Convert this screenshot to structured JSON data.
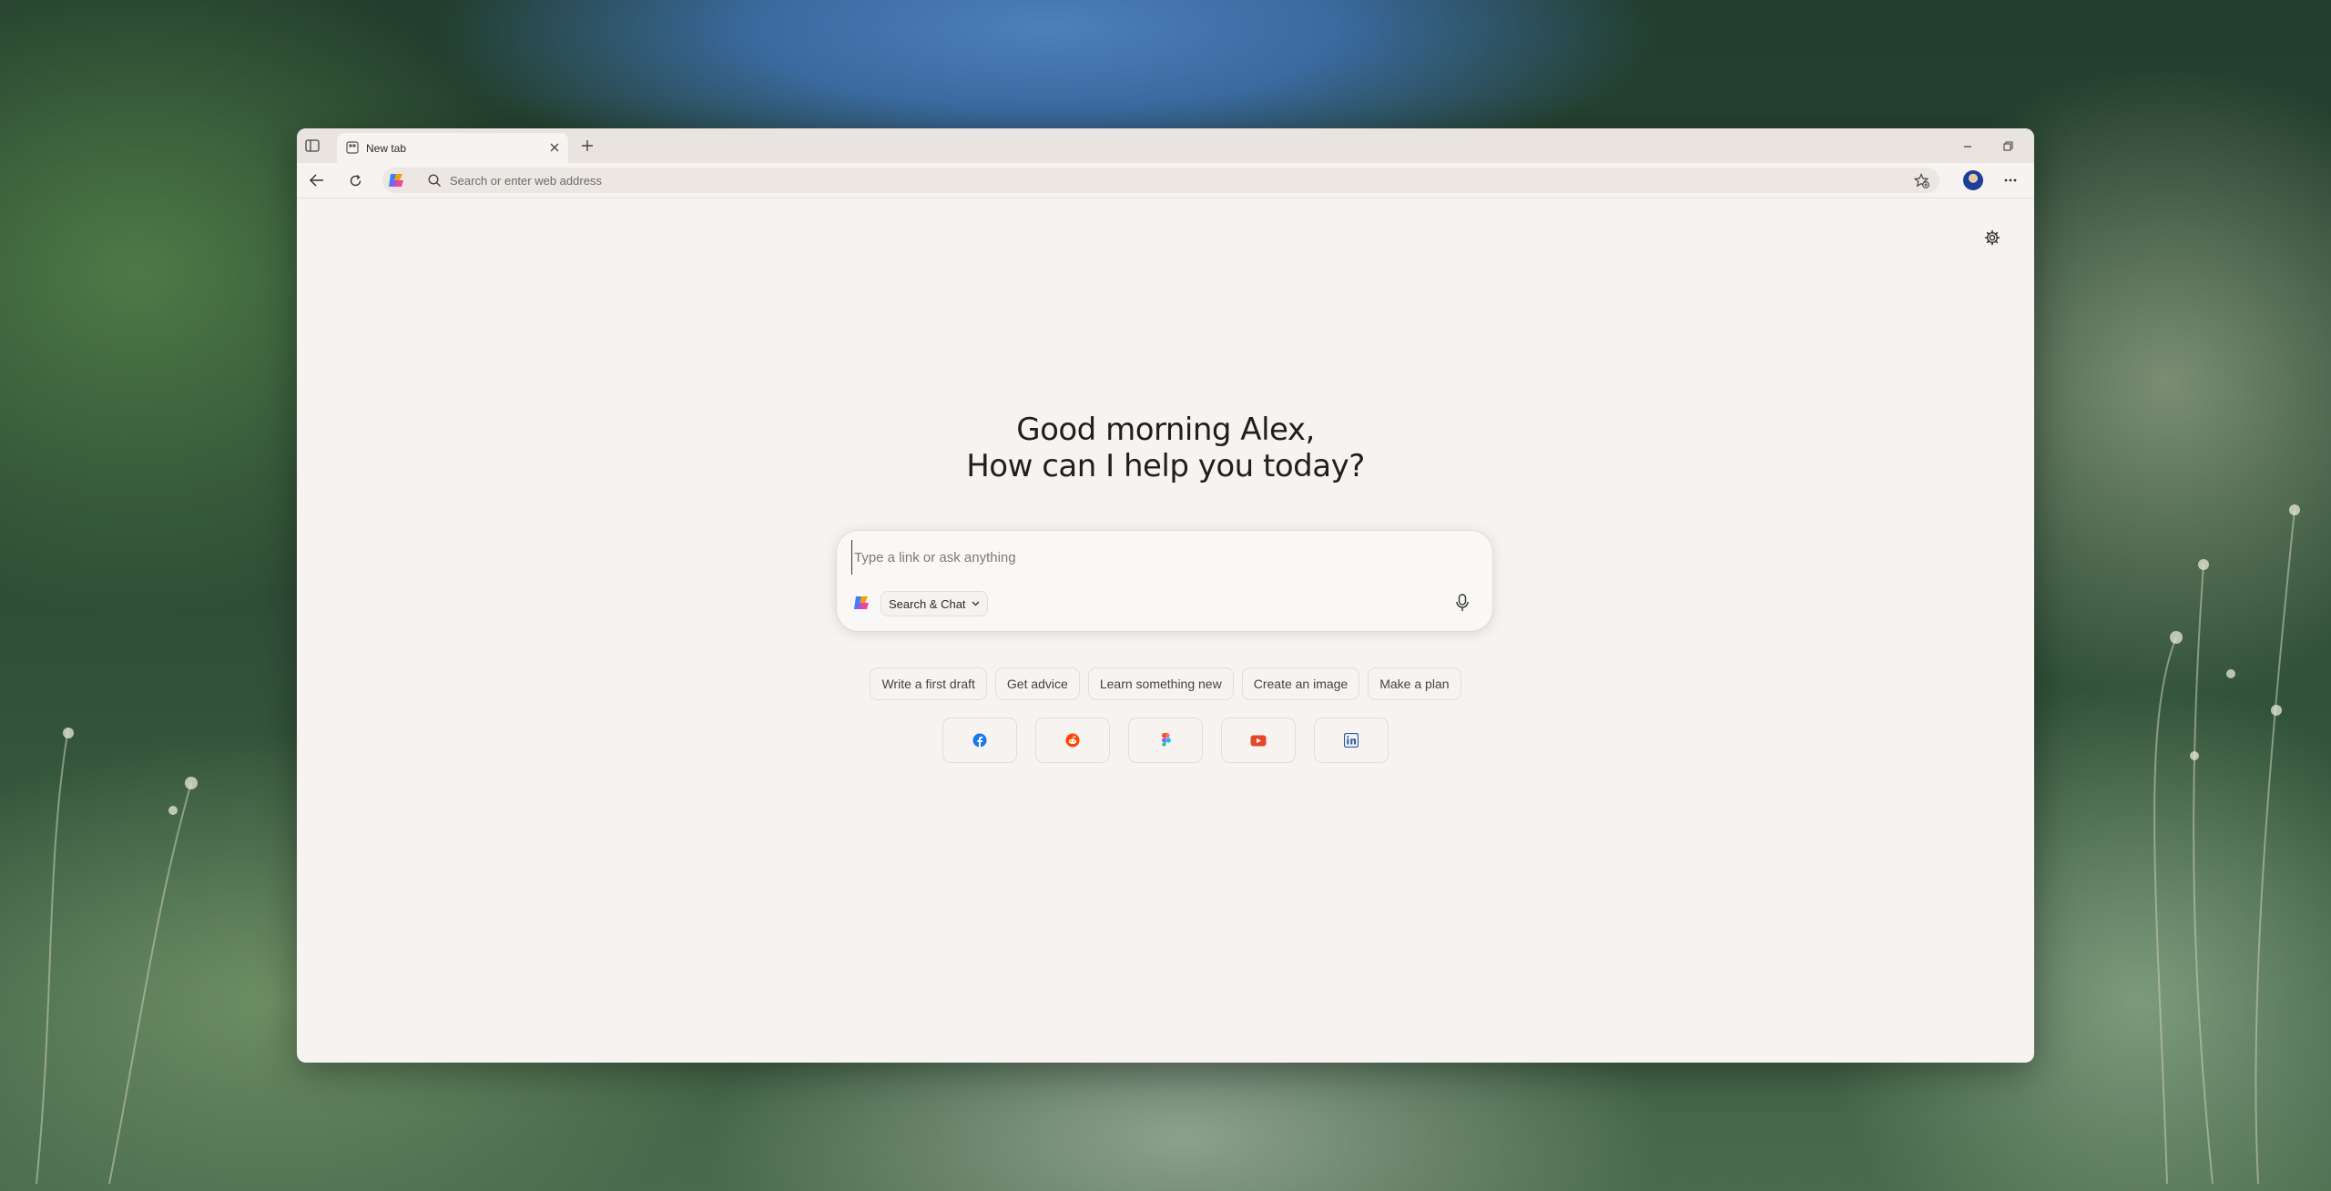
{
  "tab": {
    "title": "New tab"
  },
  "address_bar": {
    "placeholder": "Search or enter web address"
  },
  "greeting": {
    "line1": "Good morning Alex,",
    "line2": "How can I help you today?"
  },
  "chat": {
    "placeholder": "Type a link or ask anything",
    "mode_label": "Search & Chat"
  },
  "suggestions": [
    "Write a first draft",
    "Get advice",
    "Learn something new",
    "Create an image",
    "Make a plan"
  ],
  "shortcuts": [
    {
      "name": "facebook-icon",
      "color": "#1877f2"
    },
    {
      "name": "reddit-icon",
      "color": "#ff4500"
    },
    {
      "name": "figma-icon",
      "color": "#a259ff"
    },
    {
      "name": "youtube-icon",
      "color": "#ff0000"
    },
    {
      "name": "linkedin-icon",
      "color": "#0a66c2"
    }
  ],
  "colors": {
    "page_background": "#f7f3f0",
    "tab_strip": "#e9e4e0",
    "text": "#1f1f1f"
  }
}
